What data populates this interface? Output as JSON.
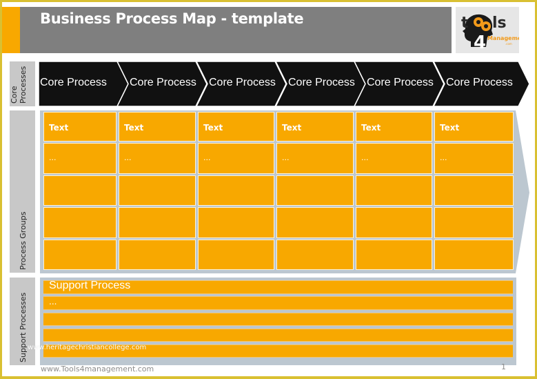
{
  "header": {
    "title": "Business Process Map - template",
    "logo": {
      "icon": "tools4management-logo",
      "text_main": "tools",
      "text_number": "4",
      "text_sub": "Management",
      "text_suffix": ".com"
    }
  },
  "side_labels": {
    "core": [
      "Core",
      "Processes"
    ],
    "groups": "Process Groups",
    "support": "Support Processes"
  },
  "core_processes": [
    {
      "label": "Core Process"
    },
    {
      "label": "Core Process"
    },
    {
      "label": "Core Process"
    },
    {
      "label": "Core Process"
    },
    {
      "label": "Core Process"
    },
    {
      "label": "Core Process"
    }
  ],
  "process_groups": {
    "rows": [
      [
        "Text",
        "Text",
        "Text",
        "Text",
        "Text",
        "Text"
      ],
      [
        "...",
        "...",
        "...",
        "...",
        "...",
        "..."
      ],
      [
        "",
        "",
        "",
        "",
        "",
        ""
      ],
      [
        "",
        "",
        "",
        "",
        "",
        ""
      ],
      [
        "",
        "",
        "",
        "",
        "",
        ""
      ]
    ]
  },
  "support_processes": {
    "rows": [
      "Support Process",
      "...",
      "",
      "",
      ""
    ]
  },
  "watermark": "www.heritagechristiancollege.com",
  "footer": {
    "url": "www.Tools4management.com",
    "page_number": "1"
  },
  "colors": {
    "accent_orange": "#f8a800",
    "frame_gold": "#d9c032",
    "title_gray": "#7f7f7f",
    "chevron_black": "#111111",
    "panel_bluegray": "#bcc7d0",
    "label_gray": "#c8c8c8"
  }
}
